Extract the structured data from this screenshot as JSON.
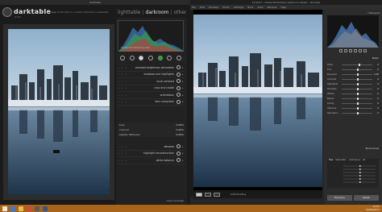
{
  "darktable": {
    "window_title": "darktable",
    "app_name": "darktable",
    "version": "2.4.0",
    "status": "1 image of 20 (#1) in current collection is selected",
    "views": [
      "lighttable",
      "darkroom",
      "other"
    ],
    "active_view": "darkroom",
    "histogram_info": "1/1000 f/2.8 100mm iso 100",
    "modules_top": [
      "contrast brightness saturation",
      "shadows and highlights",
      "local contrast",
      "crop and rotate",
      "orientation",
      "lens correction"
    ],
    "sliders": [
      {
        "name": "blue",
        "value": "0.06%"
      },
      {
        "name": "channel",
        "value": "0.00%"
      },
      {
        "name": "slightly flattened",
        "value": "0.00%"
      }
    ],
    "modules_bottom": [
      "denoise",
      "highlight reconstruction",
      "white balance"
    ],
    "more_modules": "more modules"
  },
  "lightroom": {
    "window_title": "12-2017 - Adobe Photoshop Lightroom Classic - Develop",
    "menu": [
      "File",
      "Edit",
      "Develop",
      "Photo",
      "Settings",
      "Tools",
      "View",
      "Window",
      "Help"
    ],
    "histogram_label": "Histogram",
    "basic_label": "Basic",
    "rows": [
      {
        "k": "Temp",
        "v": "0",
        "pos": 0.55
      },
      {
        "k": "Tint",
        "v": "0",
        "pos": 0.5
      },
      {
        "k": "Exposure",
        "v": "0.00",
        "pos": 0.5
      },
      {
        "k": "Contrast",
        "v": "0",
        "pos": 0.5
      },
      {
        "k": "Highlights",
        "v": "0",
        "pos": 0.5
      },
      {
        "k": "Shadows",
        "v": "0",
        "pos": 0.5
      },
      {
        "k": "Whites",
        "v": "0",
        "pos": 0.5
      },
      {
        "k": "Blacks",
        "v": "0",
        "pos": 0.5
      },
      {
        "k": "Clarity",
        "v": "0",
        "pos": 0.5
      },
      {
        "k": "Vibrance",
        "v": "0",
        "pos": 0.5
      },
      {
        "k": "Saturation",
        "v": "0",
        "pos": 0.5
      }
    ],
    "tone_curve_label": "Tone Curve",
    "hsl_tabs": [
      "Hue",
      "Saturation",
      "Luminance",
      "All"
    ],
    "soft_proofing": "Soft Proofing",
    "buttons": [
      "Previous",
      "Reset"
    ]
  },
  "taskbar": {
    "time": "11:07",
    "date": "12/05/2017"
  },
  "colors": {
    "taskbar": "#a8641a",
    "darktable_bg": "#1b1b1b",
    "lightroom_bg": "#262626"
  }
}
